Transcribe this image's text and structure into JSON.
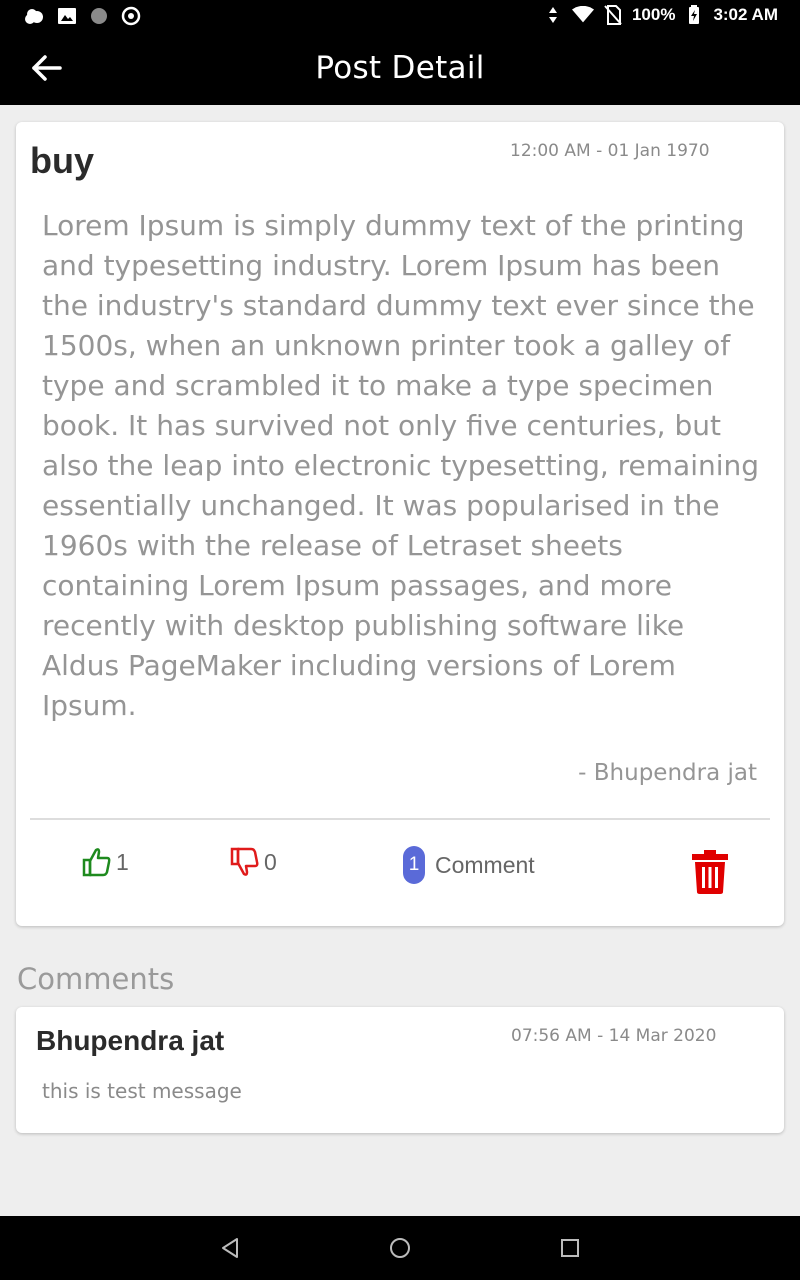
{
  "status_bar": {
    "battery": "100%",
    "time": "3:02 AM",
    "left_icons": [
      "weather-icon",
      "image-icon",
      "dot-icon",
      "chrome-icon"
    ],
    "right_icons": [
      "data-arrows-icon",
      "wifi-icon",
      "no-sim-icon",
      "battery-icon"
    ]
  },
  "app_bar": {
    "title": "Post Detail",
    "back_icon": "arrow-left-icon"
  },
  "post": {
    "title": "buy",
    "date": "12:00 AM - 01 Jan 1970",
    "body": "Lorem Ipsum is simply dummy text of the printing and typesetting industry. Lorem Ipsum has been the industry's standard dummy text ever since the 1500s, when an unknown printer took a galley of type and scrambled it to make a type specimen book. It has survived not only five centuries, but also the leap into electronic typesetting, remaining essentially unchanged. It was popularised in the 1960s with the release of Letraset sheets containing Lorem Ipsum passages, and more recently with desktop publishing software like Aldus PageMaker including versions of Lorem Ipsum.",
    "author": "- Bhupendra jat",
    "likes": "1",
    "dislikes": "0",
    "comment_count": "1",
    "comment_label": "Comment",
    "colors": {
      "like": "#1e8a1e",
      "dislike": "#e01b1b",
      "delete": "#e00000",
      "badge": "#5a6ad8"
    }
  },
  "comments": {
    "heading": "Comments",
    "items": [
      {
        "author": "Bhupendra jat",
        "date": "07:56 AM - 14 Mar 2020",
        "text": "this is test message"
      }
    ]
  },
  "nav_bar": {
    "icons": [
      "back-triangle-icon",
      "home-circle-icon",
      "recents-square-icon"
    ]
  }
}
